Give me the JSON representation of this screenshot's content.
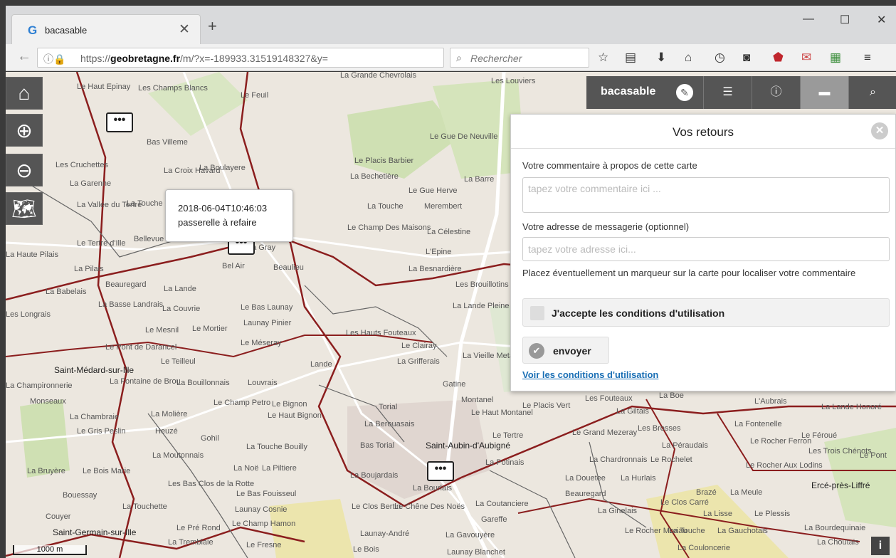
{
  "browser": {
    "tab_title": "bacasable",
    "tab_favicon": "G",
    "url_prefix": "https://",
    "url_domain": "geobretagne.fr",
    "url_path": "/m/?x=-189933.31519148327&y=",
    "search_placeholder": "Rechercher"
  },
  "app": {
    "title": "bacasable",
    "toolbar_icons": [
      "edit-icon",
      "list-icon",
      "info-icon",
      "comment-icon",
      "search-icon"
    ]
  },
  "popup": {
    "timestamp": "2018-06-04T10:46:03",
    "text": "passerelle à refaire"
  },
  "feedback": {
    "title": "Vos retours",
    "comment_label": "Votre commentaire à propos de cette carte",
    "comment_placeholder": "tapez votre commentaire ici ...",
    "email_label": "Votre adresse de messagerie (optionnel)",
    "email_placeholder": "tapez votre adresse ici...",
    "marker_hint": "Placez éventuellement un marqueur sur la carte pour localiser votre commentaire",
    "accept_label": "J'accepte les conditions d'utilisation",
    "send_label": "envoyer",
    "terms_link": "Voir les conditions d'utilisation"
  },
  "map": {
    "scale_label": "1000 m",
    "marker_glyph": "•••",
    "places": [
      "Les Champs Blancs",
      "Le Feuil",
      "Bas Villeme",
      "Les Cruchettes",
      "La Garenne",
      "La Croix Havard",
      "La Boulayere",
      "La Vallée du Tertre",
      "La Touche Gauthier",
      "Le Tertre d'Ille",
      "La Haute Pilais",
      "La Pilais",
      "Beauregard",
      "La Lande",
      "La Babelais",
      "La Basse Landrais",
      "La Couvrie",
      "Les Longrais",
      "Le Mesnil",
      "Le Mortier",
      "Le Bas Launay",
      "Launay Pinier",
      "Le Méseray",
      "Le Pont de Darancel",
      "Saint-Médard-sur-Ille",
      "Le Teilleul",
      "La Champironnerie",
      "La Fontaine de Brou",
      "La Bouillonnais",
      "Louvrais",
      "Monseaux",
      "La Chambraie",
      "La Molière",
      "Le Champ Petro",
      "Le Bignon",
      "Le Haut Bignon",
      "Le Gris Peslin",
      "Heuzé",
      "Gohil",
      "La Moutonnais",
      "La Touche Bouilly",
      "La Noë",
      "La Piltiere",
      "La Bruyère",
      "Le Bois Marie",
      "Bouessay",
      "Les Bas Clos de la Rotte",
      "Le Bas Fouisseul",
      "La Touchette",
      "Couyer",
      "Saint-Germain-sur-Ille",
      "Le Pré Rond",
      "La Tremblaie",
      "Launay Cosnie",
      "Le Champ Hamon",
      "Le Fresne",
      "Le Placis Barbier",
      "La Bechetière",
      "Le Gue Herve",
      "La Touche",
      "Merembert",
      "Le Champ Des Maisons",
      "La Célestine",
      "L'Epine",
      "La Besnardière",
      "Les Brouillotins",
      "La Lande Pleine",
      "Les Hauts Fouteaux",
      "Le Clairay",
      "La Grifferais",
      "La Vieille Metairie",
      "Lande",
      "Gatine",
      "Montanel",
      "Torial",
      "Le Haut Montanel",
      "La Berouasais",
      "Le Tertre",
      "Bas Torial",
      "Saint-Aubin-d'Aubigné",
      "La Potinais",
      "La Boujardais",
      "La Bourlais",
      "La Coutanciere",
      "Le Clos Bertin",
      "Le Chêne Des Noës",
      "Gareffe",
      "Launay-André",
      "La Gavouyère",
      "Le Bois",
      "Launay Blanchet",
      "Le Gue De Neuville",
      "La Barre",
      "Les Louviers",
      "La Grande Chevrolais",
      "Le Placis Vert",
      "Les Fouteaux",
      "La Boe",
      "La Giltais",
      "Le Grand Mezeray",
      "Les Brosses",
      "La Chardronnais",
      "Le Rochelet",
      "La Douetee",
      "La Hurlais",
      "Beauregard",
      "La Ginelais",
      "Le Clos Carré",
      "Le Rocher Moriau",
      "La Touche",
      "La Gauchotais",
      "La Lisse",
      "Le Plessis",
      "L'Aubrais",
      "La Lande Honoré",
      "La Fontenelle",
      "Le Féroué",
      "Les Trois Chénots",
      "Le Pont",
      "Le Rocher Ferron",
      "Le Rocher Aux Lodins",
      "Brazé",
      "La Meule",
      "Ercé-près-Liffré",
      "La Bourdequinaie",
      "La Choutais",
      "La Péraudais",
      "La Couloncerie",
      "Le Haut Epinay",
      "Bellevue",
      "Bel Air",
      "Beaulieu",
      "La Gray"
    ]
  }
}
